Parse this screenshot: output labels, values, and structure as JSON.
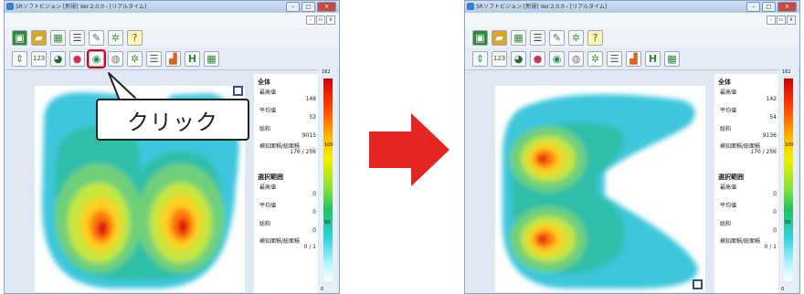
{
  "window_title": "SRソフトビジョン [新規] Ver.2.0.0 - [リアルタイム]",
  "toolbar1_icons": [
    "open-folder-icon",
    "folder-icon",
    "grid-icon",
    "list-icon",
    "pen-icon",
    "settings-icon",
    "help-icon"
  ],
  "toolbar2_icons": [
    "updown-icon",
    "number-123-icon",
    "contour-icon",
    "color-icon",
    "region-icon",
    "camera-icon",
    "settings-icon",
    "list-icon",
    "bar-graph-icon",
    "h-icon",
    "grid-icon"
  ],
  "callout_label": "クリック",
  "left": {
    "summary": {
      "header": "全体",
      "max_label": "最高値",
      "max_value": "148",
      "avg_label": "平均値",
      "avg_value": "53",
      "sum_label": "総和",
      "sum_value": "9015",
      "area_label": "検知面積/総面積",
      "area_value": "176 / 256"
    },
    "selection": {
      "header": "選択範囲",
      "max_label": "最高値",
      "max_value": "0",
      "avg_label": "平均値",
      "avg_value": "0",
      "sum_label": "総和",
      "sum_value": "0",
      "area_label": "検知面積/総面積",
      "area_value": "0 / 1"
    },
    "scale": {
      "top": "162",
      "ticks": [
        "100",
        "50"
      ],
      "bottom": "0"
    }
  },
  "right": {
    "summary": {
      "header": "全体",
      "max_label": "最高値",
      "max_value": "142",
      "avg_label": "平均値",
      "avg_value": "54",
      "sum_label": "総和",
      "sum_value": "9136",
      "area_label": "検知面積/総面積",
      "area_value": "170 / 256"
    },
    "selection": {
      "header": "選択範囲",
      "max_label": "最高値",
      "max_value": "0",
      "avg_label": "平均値",
      "avg_value": "0",
      "sum_label": "総和",
      "sum_value": "0",
      "area_label": "検知面積/総面積",
      "area_value": "0 / 1"
    },
    "scale": {
      "top": "162",
      "ticks": [
        "100",
        "50"
      ],
      "bottom": "0"
    }
  },
  "colors": {
    "accent_red": "#e52521",
    "highlight_border": "#e0001b"
  }
}
